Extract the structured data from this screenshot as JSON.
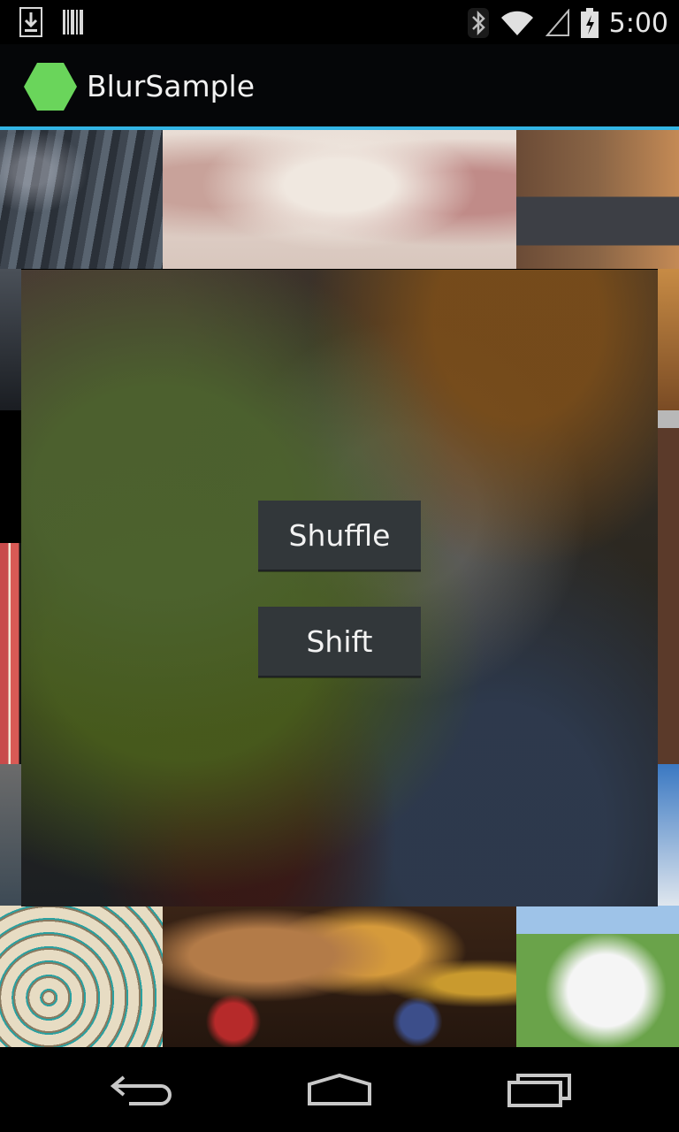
{
  "status_bar": {
    "time": "5:00",
    "icons": [
      "download-icon",
      "barcode-icon",
      "bluetooth-icon",
      "wifi-icon",
      "signal-icon",
      "battery-icon"
    ]
  },
  "action_bar": {
    "title": "BlurSample",
    "accent_color": "#33b5e5",
    "icon_color": "#6ad55b"
  },
  "grid": {
    "tiles": [
      "rain-umbrellas-photo",
      "snowy-forest-photo",
      "elevated-train-photo",
      "pencils-photo",
      "brick-building-photo",
      "coiled-rope-photo",
      "still-life-pumpkin-photo",
      "sketch-boy-photo"
    ]
  },
  "blur_panel": {
    "shuffle_label": "Shuffle",
    "shift_label": "Shift"
  },
  "nav_bar": {
    "icons": [
      "back-icon",
      "home-icon",
      "recents-icon"
    ]
  }
}
